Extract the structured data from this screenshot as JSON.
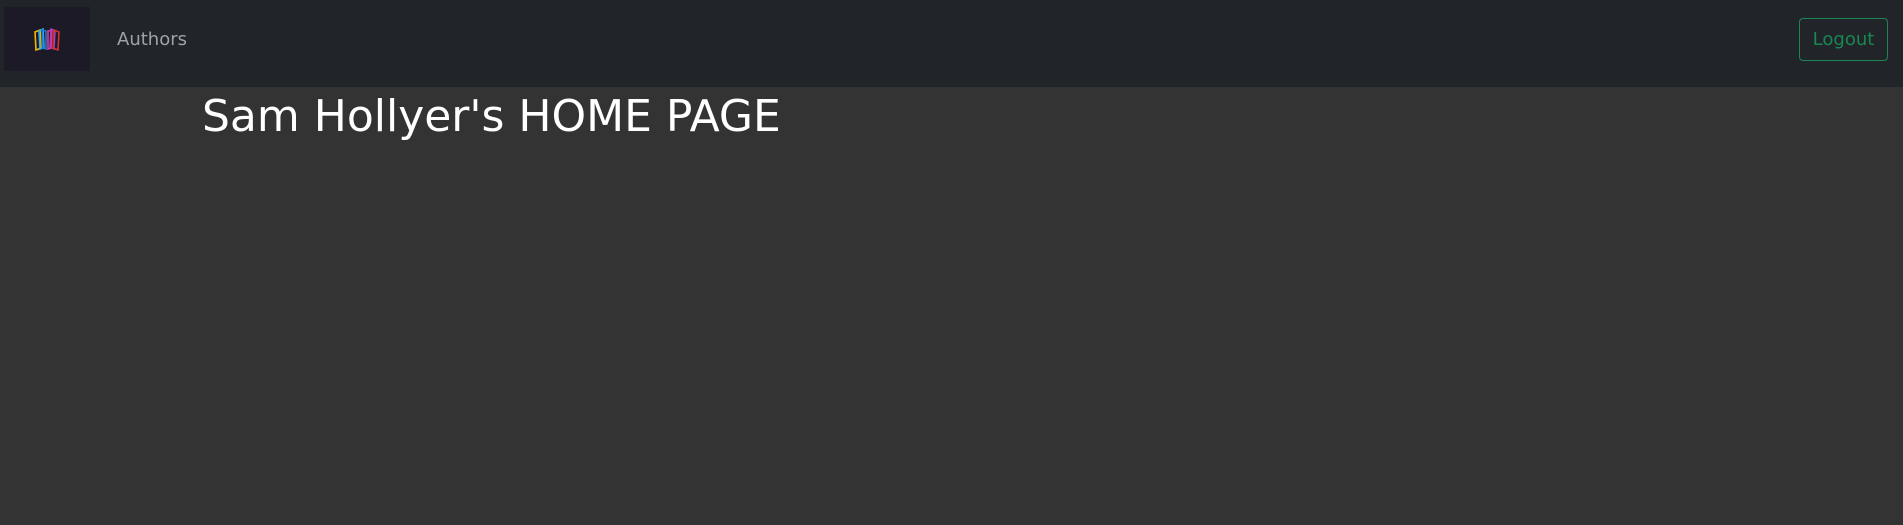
{
  "navbar": {
    "logo_icon": "open-book-logo-icon",
    "authors_link": "Authors",
    "logout_label": "Logout"
  },
  "main": {
    "title": "Sam Hollyer's HOME PAGE"
  },
  "colors": {
    "navbar_bg": "#212529",
    "page_bg": "#333333",
    "logout_accent": "#198754",
    "logo_bg": "#1b1a26"
  }
}
